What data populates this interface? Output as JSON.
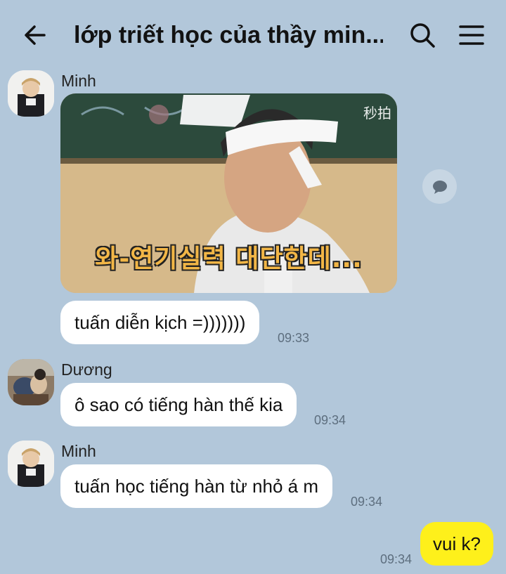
{
  "header": {
    "title": "lớp triết học của thầy min...",
    "back_icon": "arrow-left-icon",
    "search_icon": "search-icon",
    "menu_icon": "hamburger-menu-icon"
  },
  "messages": [
    {
      "sender": "Minh",
      "image": {
        "caption": "와-연기실력 대단한데...",
        "watermark": "秒拍"
      },
      "text": "tuấn diễn kịch =)))))))",
      "time": "09:33"
    },
    {
      "sender": "Dương",
      "text": "ô sao có tiếng hàn thế kia",
      "time": "09:34"
    },
    {
      "sender": "Minh",
      "text": "tuấn học tiếng hàn từ nhỏ á m",
      "time": "09:34"
    },
    {
      "sender": "me",
      "text": "vui k?",
      "time": "09:34"
    }
  ],
  "colors": {
    "background": "#b2c7da",
    "my_bubble": "#fef01b",
    "other_bubble": "#ffffff"
  }
}
